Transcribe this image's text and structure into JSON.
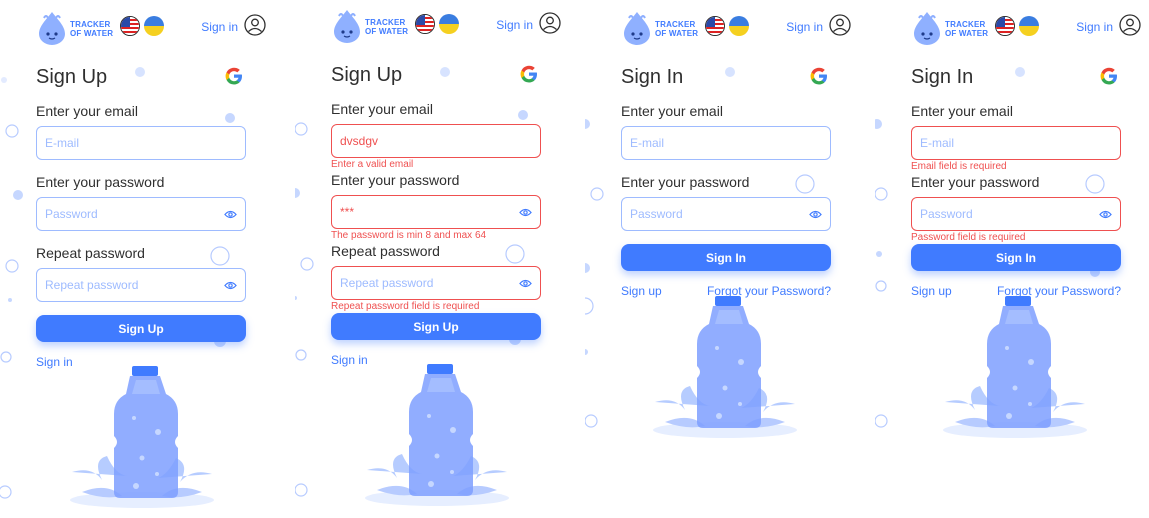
{
  "common": {
    "logo_line1": "TRACKER",
    "logo_line2": "OF WATER",
    "header_signin": "Sign in",
    "email_label": "Enter your email",
    "password_label": "Enter your password",
    "repeat_label": "Repeat password",
    "email_placeholder": "E-mail",
    "password_placeholder": "Password",
    "repeat_placeholder": "Repeat password",
    "accent": "#407bff",
    "error": "#ef5050"
  },
  "panel1": {
    "title": "Sign Up",
    "button": "Sign Up",
    "footer_link": "Sign in"
  },
  "panel2": {
    "title": "Sign Up",
    "email_value": "dvsdgv",
    "email_error": "Enter a valid email",
    "password_value": "***",
    "password_error": "The password is min 8 and max 64",
    "repeat_error": "Repeat password field is required",
    "button": "Sign Up",
    "footer_link": "Sign in"
  },
  "panel3": {
    "title": "Sign In",
    "button": "Sign In",
    "signup_link": "Sign up",
    "forgot_link": "Forgot your Password?"
  },
  "panel4": {
    "title": "Sign In",
    "email_error": "Email field is required",
    "password_error": "Password field is required",
    "button": "Sign In",
    "signup_link": "Sign up",
    "forgot_link": "Forgot your Password?"
  }
}
